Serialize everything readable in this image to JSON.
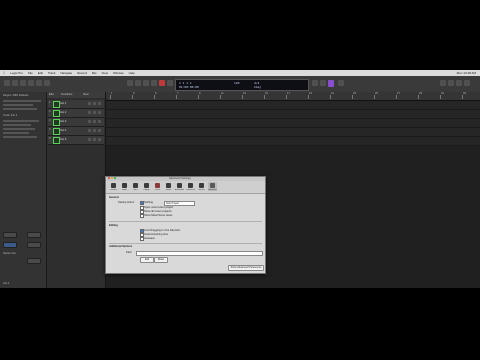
{
  "menubar": {
    "items": [
      "Logic Pro",
      "File",
      "Edit",
      "Track",
      "Navigate",
      "Record",
      "Mix",
      "View",
      "Window",
      "Help"
    ],
    "clock": "Mon 10:48 AM"
  },
  "lcd": {
    "position": "1 1 1 1",
    "time": "01:00:00:00",
    "tempo": "120",
    "signature": "4/4",
    "key": "Cmaj"
  },
  "inspector": {
    "region_label": "Region: MIDI Defaults",
    "track_label": "Track: Inst 1",
    "stereo_out": "Stereo Out",
    "bnce": "Bnce",
    "inst_label": "Inst 1"
  },
  "tracks": {
    "header_labels": [
      "Edit",
      "Functions",
      "View"
    ],
    "items": [
      {
        "num": "1",
        "name": "Inst 1"
      },
      {
        "num": "2",
        "name": "Inst 2"
      },
      {
        "num": "3",
        "name": "Inst 3"
      },
      {
        "num": "4",
        "name": "Inst 4"
      },
      {
        "num": "5",
        "name": "Inst 5"
      }
    ]
  },
  "ruler": {
    "marks": [
      "1",
      "3",
      "5",
      "7",
      "9",
      "11",
      "13",
      "15",
      "17",
      "19",
      "21",
      "23",
      "25",
      "27",
      "29",
      "31",
      "33"
    ]
  },
  "dialog": {
    "title": "Advanced Settings",
    "tabs": [
      "General",
      "Audio",
      "MIDI",
      "Display",
      "Score",
      "Movie",
      "Automation",
      "Control Surfaces",
      "My Info",
      "Advanced"
    ],
    "section_general": "General",
    "startup_label": "Startup Action:",
    "startup_value": "Nothing",
    "startup_option": "New Project",
    "checks": [
      "Open most recent project",
      "Show all recent projects",
      "Show Mixer/Score views"
    ],
    "section_2": "Editing",
    "checks2": [
      "Limit Dragging to One Direction",
      "Avoid stretching time",
      "Autosave"
    ],
    "section_3": "Additional Options",
    "path_label": "Path:",
    "btn_default": "Edit",
    "btn_reset": "Reset",
    "footer_btn": "Show Advanced Preferences"
  },
  "colors": {
    "track_icon": "#5ad15a",
    "accent": "#8a4fd0",
    "checkbox_on": "#3a7bd5"
  }
}
